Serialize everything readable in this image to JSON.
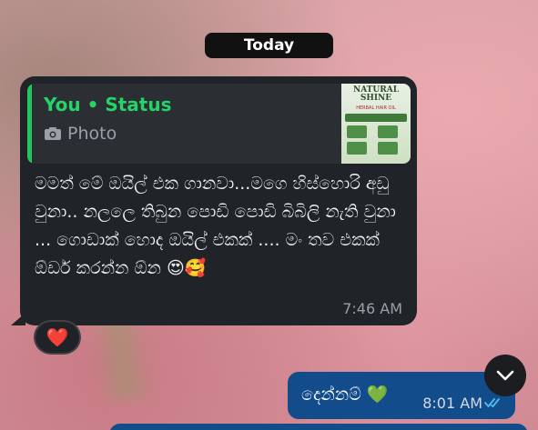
{
  "date_divider": "Today",
  "incoming": {
    "quote": {
      "sender": "You • Status",
      "type_label": "Photo",
      "thumbnail_title": "NATURAL SHINE",
      "thumbnail_subtitle": "HERBAL HAIR OIL"
    },
    "text": "මමත් මේ ඔයිල් එක ගානවා...මගෙ හිස්හොරි අඩු වුනා.. නලලෙ තිබුන පොඩි පොඩි බිබිලි නැති වුනා ... ගොඩාක් හොද ඔයිල් එකක් .... මං තව එකක් ඕඩර් කරන්න ඕන 😍🥰",
    "time": "7:46 AM",
    "reaction": "❤️"
  },
  "outgoing": {
    "text": "දෙන්නම් 💚",
    "time": "8:01 AM",
    "status_icon": "double-check-icon"
  },
  "colors": {
    "incoming_bg": "#202327",
    "outgoing_bg": "#124c8b",
    "accent_green": "#25d366",
    "read_tick_blue": "#53bdeb"
  }
}
